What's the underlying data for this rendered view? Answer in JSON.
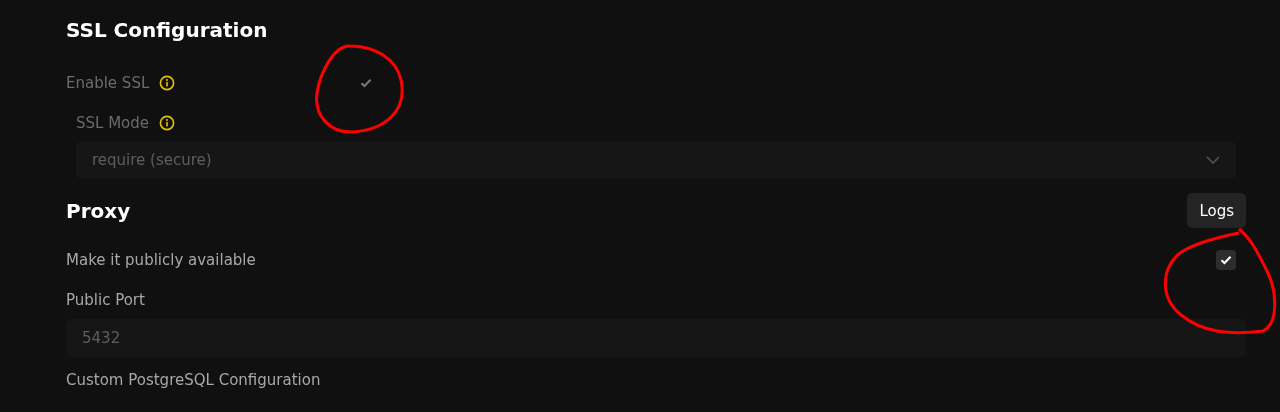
{
  "ssl": {
    "title": "SSL Configuration",
    "enable": {
      "label": "Enable SSL",
      "checked": true,
      "disabled": true
    },
    "mode": {
      "label": "SSL Mode",
      "value": "require (secure)",
      "disabled": true
    }
  },
  "proxy": {
    "title": "Proxy",
    "logs_button": "Logs",
    "public": {
      "label": "Make it publicly available",
      "checked": true,
      "disabled": false
    },
    "port": {
      "label": "Public Port",
      "value": "5432",
      "disabled": true
    }
  },
  "custom_config": {
    "label": "Custom PostgreSQL Configuration"
  }
}
